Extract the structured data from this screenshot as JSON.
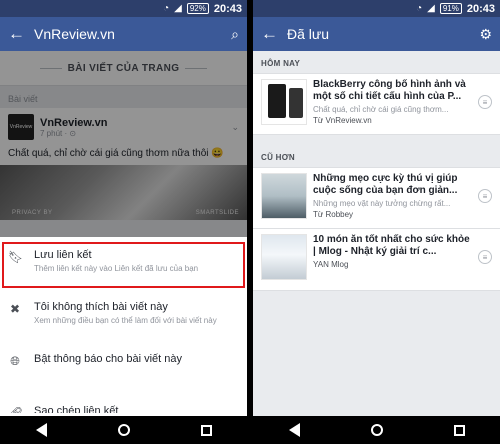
{
  "left_screen": {
    "status": {
      "battery": "92%",
      "time": "20:43"
    },
    "appbar": {
      "title": "VnReview.vn",
      "search_icon": "search-icon"
    },
    "section_header": "BÀI VIẾT CỦA TRANG",
    "sub_label": "Bài viết",
    "post": {
      "logo_text": "VnReview",
      "page_name": "VnReview.vn",
      "meta": "7 phút · ⊙",
      "text": "Chất quá, chỉ chờ cái giá cũng thơm nữa thôi 😀",
      "watermark_left": "PRIVACY BY",
      "watermark_right": "SMARTSLIDE"
    },
    "sheet_options": [
      {
        "icon": "bookmark-icon",
        "title": "Lưu liên kết",
        "description": "Thêm liên kết này vào Liên kết đã lưu của bạn",
        "highlighted": true
      },
      {
        "icon": "close-x-icon",
        "title": "Tôi không thích bài viết này",
        "description": "Xem những điều bạn có thể làm đối với bài viết này"
      },
      {
        "icon": "globe-icon",
        "title": "Bật thông báo cho bài viết này",
        "description": ""
      },
      {
        "icon": "link-icon",
        "title": "Sao chép liên kết",
        "description": ""
      }
    ]
  },
  "right_screen": {
    "status": {
      "battery": "91%",
      "time": "20:43"
    },
    "appbar": {
      "title": "Đã lưu",
      "filter_icon": "filter-icon"
    },
    "groups": [
      {
        "header": "HÔM NAY",
        "items": [
          {
            "title": "BlackBerry công bố hình ảnh và một số chi tiết cấu hình của P...",
            "subtitle": "Chất quá, chỉ chờ cái giá cũng thơm...",
            "source": "Từ VnReview.vn"
          }
        ]
      },
      {
        "header": "CŨ HƠN",
        "items": [
          {
            "title": "Những mẹo cực kỳ thú vị giúp cuộc sống của bạn đơn giản...",
            "subtitle": "Những mẹo vặt này tưởng chừng rất...",
            "source": "Từ Robbey"
          },
          {
            "title": "10 món ăn tốt nhất cho sức khỏe | Mlog - Nhật ký giải trí c...",
            "subtitle": "",
            "source": "YAN Mlog"
          }
        ]
      }
    ]
  },
  "colors": {
    "facebook_blue": "#3b5998",
    "status_bar": "#2d3f6b",
    "highlight_red": "#e0191b"
  }
}
